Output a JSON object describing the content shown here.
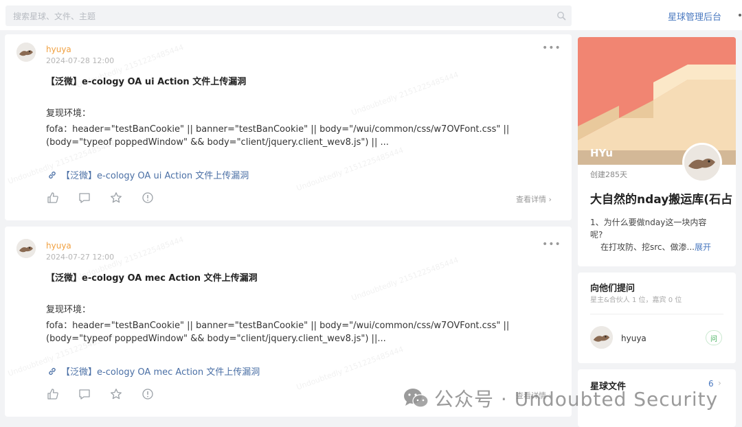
{
  "header": {
    "search_placeholder": "搜索星球、文件、主题",
    "admin_link": "星球管理后台"
  },
  "posts": [
    {
      "author": "hyuya",
      "time": "2024-07-28 12:00",
      "title": "【泛微】e-cology OA ui Action 文件上传漏洞",
      "env_label": "复现环境：",
      "line1": "fofa：header=\"testBanCookie\" || banner=\"testBanCookie\" || body=\"/wui/common/css/w7OVFont.css\" ||",
      "line2": "(body=\"typeof poppedWindow\" && body=\"client/jquery.client_wev8.js\") || ...",
      "link_text": "【泛微】e-cology OA ui Action 文件上传漏洞",
      "detail": "查看详情"
    },
    {
      "author": "hyuya",
      "time": "2024-07-27 12:00",
      "title": "【泛微】e-cology OA mec Action 文件上传漏洞",
      "env_label": "复现环境：",
      "line1": "fofa：header=\"testBanCookie\" || banner=\"testBanCookie\" || body=\"/wui/common/css/w7OVFont.css\" ||",
      "line2": "(body=\"typeof poppedWindow\" && body=\"client/jquery.client_wev8.js\") ||...",
      "link_text": "【泛微】e-cology OA mec Action 文件上传漏洞",
      "detail": "查看详情"
    }
  ],
  "group": {
    "owner": "HYu",
    "created": "创建285天",
    "name": "大自然的nday搬运库(石占",
    "desc_line1": "1、为什么要做nday这一块内容",
    "desc_line2": "呢?",
    "desc_line3": "在打攻防、挖src、做渗...",
    "expand": "展开"
  },
  "ask": {
    "title": "向他们提问",
    "subtitle": "星主&合伙人 1 位，嘉宾 0 位",
    "member": "hyuya",
    "ask_button": "问"
  },
  "files": {
    "title": "星球文件",
    "count": "6"
  },
  "watermark": {
    "brand": "公众号 · Undoubted Security",
    "tile": "Undoubtedly 2151225485444"
  },
  "colors": {
    "author": "#f0a040",
    "link": "#4a6fa5",
    "accent": "#4a79c0",
    "cover_bg": "#f18572"
  }
}
